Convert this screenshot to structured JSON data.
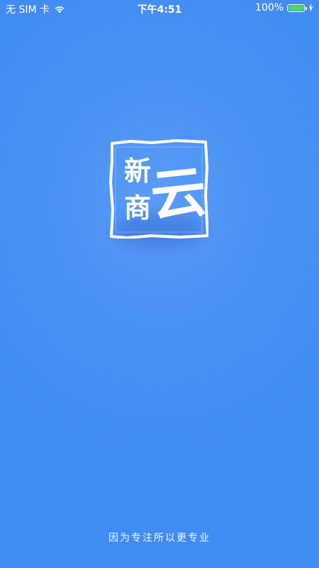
{
  "status_bar": {
    "carrier": "无 SIM 卡",
    "time": "下午4:51",
    "battery_text": "100%",
    "battery_level": 1.0,
    "battery_color": "#4cd964",
    "icons": [
      "wifi-icon",
      "battery-icon",
      "charging-icon"
    ]
  },
  "logo": {
    "text_left_top": "新",
    "text_left_bottom": "商",
    "text_right": "云"
  },
  "tagline": "因为专注所以更专业",
  "colors": {
    "background": "#4a91f4",
    "background_center": "#5b9cf8",
    "text": "#ffffff"
  }
}
